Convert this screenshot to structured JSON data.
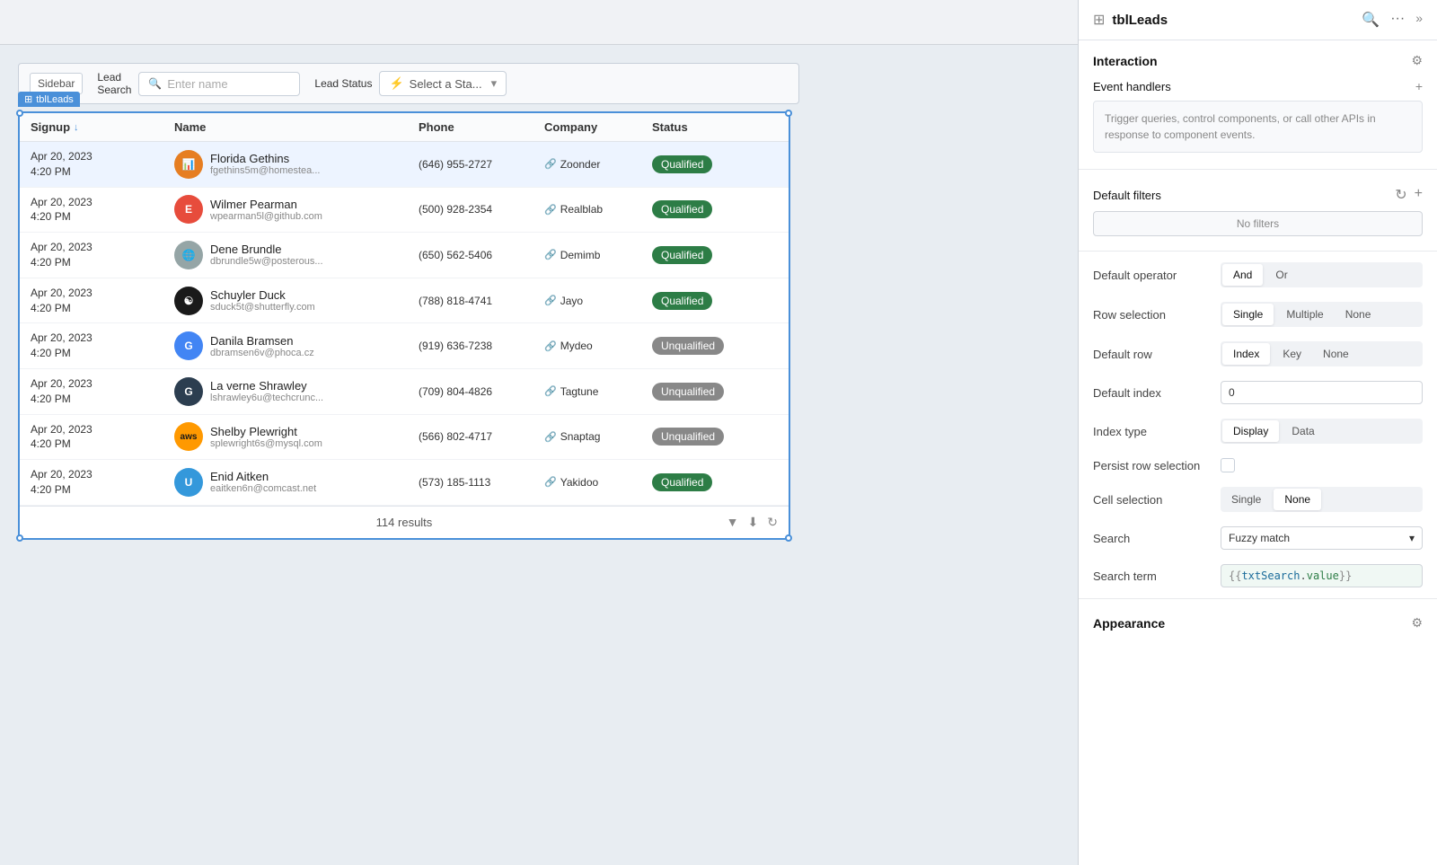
{
  "panel": {
    "title": "tblLeads",
    "grid_icon": "⊞",
    "icons": {
      "search": "🔍",
      "more": "···",
      "expand": "»"
    }
  },
  "interaction": {
    "title": "Interaction",
    "event_handlers": {
      "label": "Event handlers",
      "add_icon": "+",
      "hint": "Trigger queries, control components, or call other APIs in response to component events."
    },
    "default_filters": {
      "label": "Default filters",
      "refresh_icon": "↻",
      "add_icon": "+",
      "no_filters": "No filters"
    },
    "default_operator": {
      "label": "Default operator",
      "and": "And",
      "or": "Or"
    },
    "row_selection": {
      "label": "Row selection",
      "single": "Single",
      "multiple": "Multiple",
      "none": "None"
    },
    "default_row": {
      "label": "Default row",
      "index": "Index",
      "key": "Key",
      "none": "None"
    },
    "default_index": {
      "label": "Default index",
      "value": "0"
    },
    "index_type": {
      "label": "Index type",
      "display": "Display",
      "data": "Data"
    },
    "persist_row_selection": {
      "label": "Persist row selection"
    },
    "cell_selection": {
      "label": "Cell selection",
      "single": "Single",
      "none": "None"
    },
    "search": {
      "label": "Search",
      "value": "Fuzzy match"
    },
    "search_term": {
      "label": "Search term",
      "value": "{{txtSearch.value}}"
    },
    "appearance": {
      "label": "Appearance"
    }
  },
  "table": {
    "tag": "tblLeads",
    "columns": {
      "signup": "Signup",
      "name": "Name",
      "phone": "Phone",
      "company": "Company",
      "status": "Status"
    },
    "sort_col": "↓",
    "results": "114 results",
    "rows": [
      {
        "signup": "Apr 20, 2023\n4:20 PM",
        "name": "Florida Gethins",
        "email": "fgethins5m@homestea...",
        "phone": "(646) 955-2727",
        "company": "Zoonder",
        "status": "Qualified",
        "avatar_bg": "#e67e22",
        "avatar_text": "chart",
        "selected": true
      },
      {
        "signup": "Apr 20, 2023\n4:20 PM",
        "name": "Wilmer Pearman",
        "email": "wpearman5l@github.com",
        "phone": "(500) 928-2354",
        "company": "Realblab",
        "status": "Qualified",
        "avatar_bg": "#e74c3c",
        "avatar_text": "E"
      },
      {
        "signup": "Apr 20, 2023\n4:20 PM",
        "name": "Dene Brundle",
        "email": "dbrundle5w@posterous...",
        "phone": "(650) 562-5406",
        "company": "Demimb",
        "status": "Qualified",
        "avatar_bg": "#95a5a6",
        "avatar_text": "🌐"
      },
      {
        "signup": "Apr 20, 2023\n4:20 PM",
        "name": "Schuyler Duck",
        "email": "sduck5t@shutterfly.com",
        "phone": "(788) 818-4741",
        "company": "Jayo",
        "status": "Qualified",
        "avatar_bg": "#1a1a1a",
        "avatar_text": "☯"
      },
      {
        "signup": "Apr 20, 2023\n4:20 PM",
        "name": "Danila Bramsen",
        "email": "dbramsen6v@phoca.cz",
        "phone": "(919) 636-7238",
        "company": "Mydeo",
        "status": "Unqualified",
        "avatar_bg": "#4285f4",
        "avatar_text": "G"
      },
      {
        "signup": "Apr 20, 2023\n4:20 PM",
        "name": "La verne Shrawley",
        "email": "lshrawley6u@techcrunc...",
        "phone": "(709) 804-4826",
        "company": "Tagtune",
        "status": "Unqualified",
        "avatar_bg": "#2c3e50",
        "avatar_text": "G"
      },
      {
        "signup": "Apr 20, 2023\n4:20 PM",
        "name": "Shelby Plewright",
        "email": "splewright6s@mysql.com",
        "phone": "(566) 802-4717",
        "company": "Snaptag",
        "status": "Unqualified",
        "avatar_bg": "#ff9900",
        "avatar_text": "aws"
      },
      {
        "signup": "Apr 20, 2023\n4:20 PM",
        "name": "Enid Aitken",
        "email": "eaitken6n@comcast.net",
        "phone": "(573) 185-1113",
        "company": "Yakidoo",
        "status": "Qualified",
        "avatar_bg": "#3498db",
        "avatar_text": "U"
      }
    ]
  },
  "filter_bar": {
    "sidebar_label": "Sidebar",
    "lead_search_label": "Lead\nSearch",
    "search_placeholder": "Enter name",
    "lead_status_label": "Lead Status",
    "status_select_placeholder": "Select a Sta...",
    "lightning": "⚡"
  }
}
